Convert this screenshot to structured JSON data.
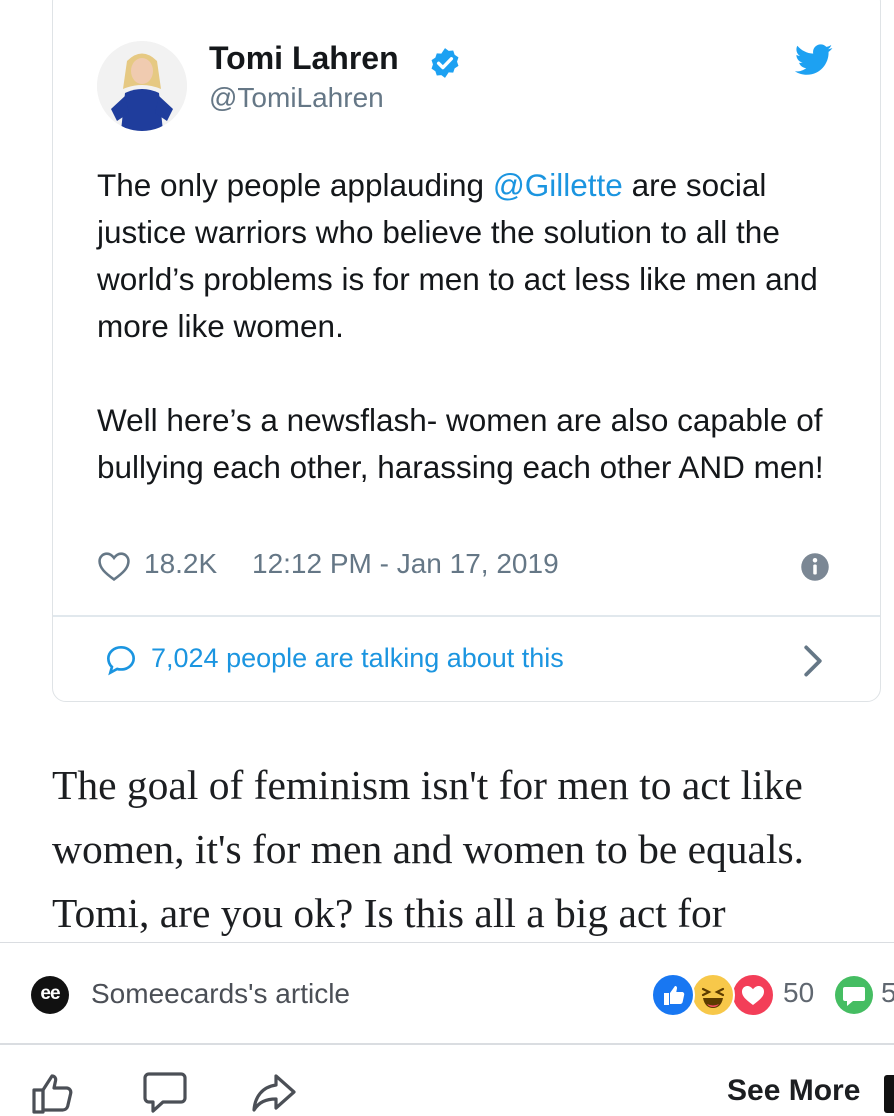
{
  "tweet": {
    "display_name": "Tomi Lahren",
    "handle": "@TomiLahren",
    "text_before_mention": "The only people applauding ",
    "mention": "@Gillette",
    "text_after_mention": " are social justice warriors who believe the solution to all the world’s problems is for men to act less like men and more like women.",
    "paragraph2": "Well here’s a newsflash- women are also capable of bullying each other, harassing each other AND men!",
    "likes": "18.2K",
    "timestamp": "12:12 PM - Jan 17, 2019",
    "conversation": "7,024 people are talking about this",
    "icons": {
      "verified": "verified-badge-icon",
      "brand": "twitter-bird-icon",
      "like": "heart-icon",
      "info": "info-icon",
      "reply": "speech-bubble-icon",
      "open": "chevron-right-icon"
    },
    "colors": {
      "accent": "#1b95e0",
      "verified": "#1da1f2",
      "muted": "#657786"
    }
  },
  "article": {
    "text": "The goal of feminism isn't for men to act like\nwomen, it's for men and women to be equals.\nTomi, are you ok? Is this all a big act for"
  },
  "post_footer": {
    "source_logo": "ee",
    "source_label": "Someecards's article",
    "reaction_count": "50",
    "comment_count": "5",
    "reactions": [
      "like-reaction-icon",
      "haha-reaction-icon",
      "love-reaction-icon"
    ],
    "colors": {
      "like": "#1877f2",
      "haha": "#f7c84a",
      "love": "#f33e58",
      "comments": "#45bd62"
    }
  },
  "actions": {
    "like": "thumbs-up-icon",
    "comment": "comment-icon",
    "share": "share-icon",
    "see_more": "See More"
  }
}
